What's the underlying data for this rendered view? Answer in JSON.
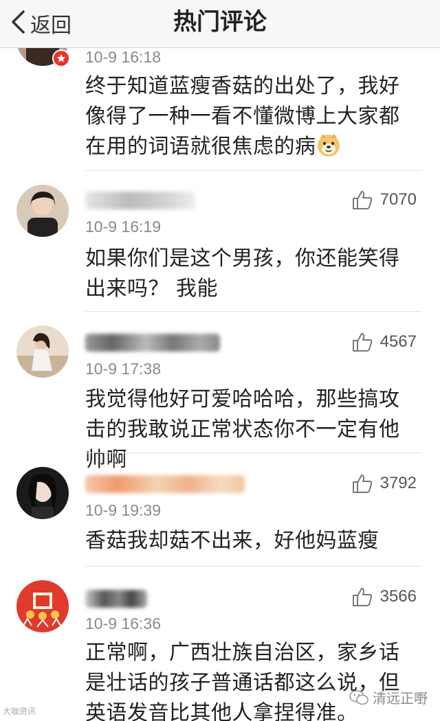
{
  "nav": {
    "back_label": "返回",
    "title": "热门评论"
  },
  "comments": [
    {
      "time": "10-9 16:18",
      "text": "终于知道蓝瘦香菇的出处了，我好像得了一种一看不懂微博上大家都在用的词语就很焦虑的病",
      "emoji": "doge-emoji"
    },
    {
      "likes": "7070",
      "time": "10-9 16:19",
      "text": "如果你们是这个男孩，你还能笑得出来吗？ 我能"
    },
    {
      "likes": "4567",
      "time": "10-9 17:38",
      "text": "我觉得他好可爱哈哈哈，那些搞攻击的我敢说正常状态你不一定有他帅啊"
    },
    {
      "likes": "3792",
      "time": "10-9 19:39",
      "text": "香菇我却菇不出来，好他妈蓝瘦"
    },
    {
      "likes": "3566",
      "time": "10-9 16:36",
      "text": "正常啊，广西壮族自治区，家乡话是壮话的孩子普通话都这么说，但英语发音比其他人拿捏得准。"
    }
  ],
  "watermark": {
    "left": "大咖资讯",
    "right": "清远正嘢"
  },
  "icons": {
    "back": "chevron-left-icon",
    "like": "thumbs-up-icon",
    "badge": "verified-badge-icon"
  },
  "colors": {
    "nav_bg": "#f7f7f7",
    "text": "#222222",
    "meta": "#8a8a8a",
    "badge": "#e8332b"
  }
}
